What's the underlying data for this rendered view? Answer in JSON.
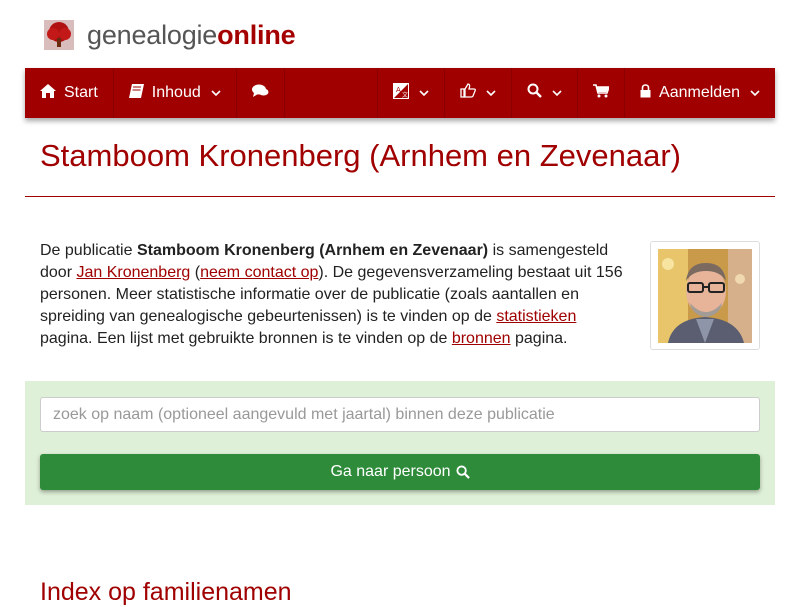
{
  "brand": {
    "part1": "genealogie",
    "part2": "online"
  },
  "nav": {
    "start": "Start",
    "inhoud": "Inhoud",
    "login": "Aanmelden"
  },
  "page": {
    "title": "Stamboom Kronenberg (Arnhem en Zevenaar)"
  },
  "intro": {
    "t1": "De publicatie ",
    "pub_name": "Stamboom Kronenberg (Arnhem en Zevenaar)",
    "t2": " is samengesteld door ",
    "author": "Jan Kronenberg",
    "t3": " (",
    "contact": "neem contact op",
    "t4": "). De gegevensverzameling bestaat uit 156 personen. Meer statistische informatie over de publicatie (zoals aantallen en spreiding van genealogische gebeurtenissen) is te vinden op de ",
    "stats": "statistieken",
    "t5": " pagina. Een lijst met gebruikte bronnen is te vinden op de ",
    "sources": "bronnen",
    "t6": " pagina."
  },
  "search": {
    "placeholder": "zoek op naam (optioneel aangevuld met jaartal) binnen deze publicatie",
    "button": "Ga naar persoon"
  },
  "index": {
    "title": "Index op familienamen"
  },
  "colors": {
    "brand": "#a00000",
    "panel": "#dff0d8",
    "button": "#2e8b3a"
  }
}
